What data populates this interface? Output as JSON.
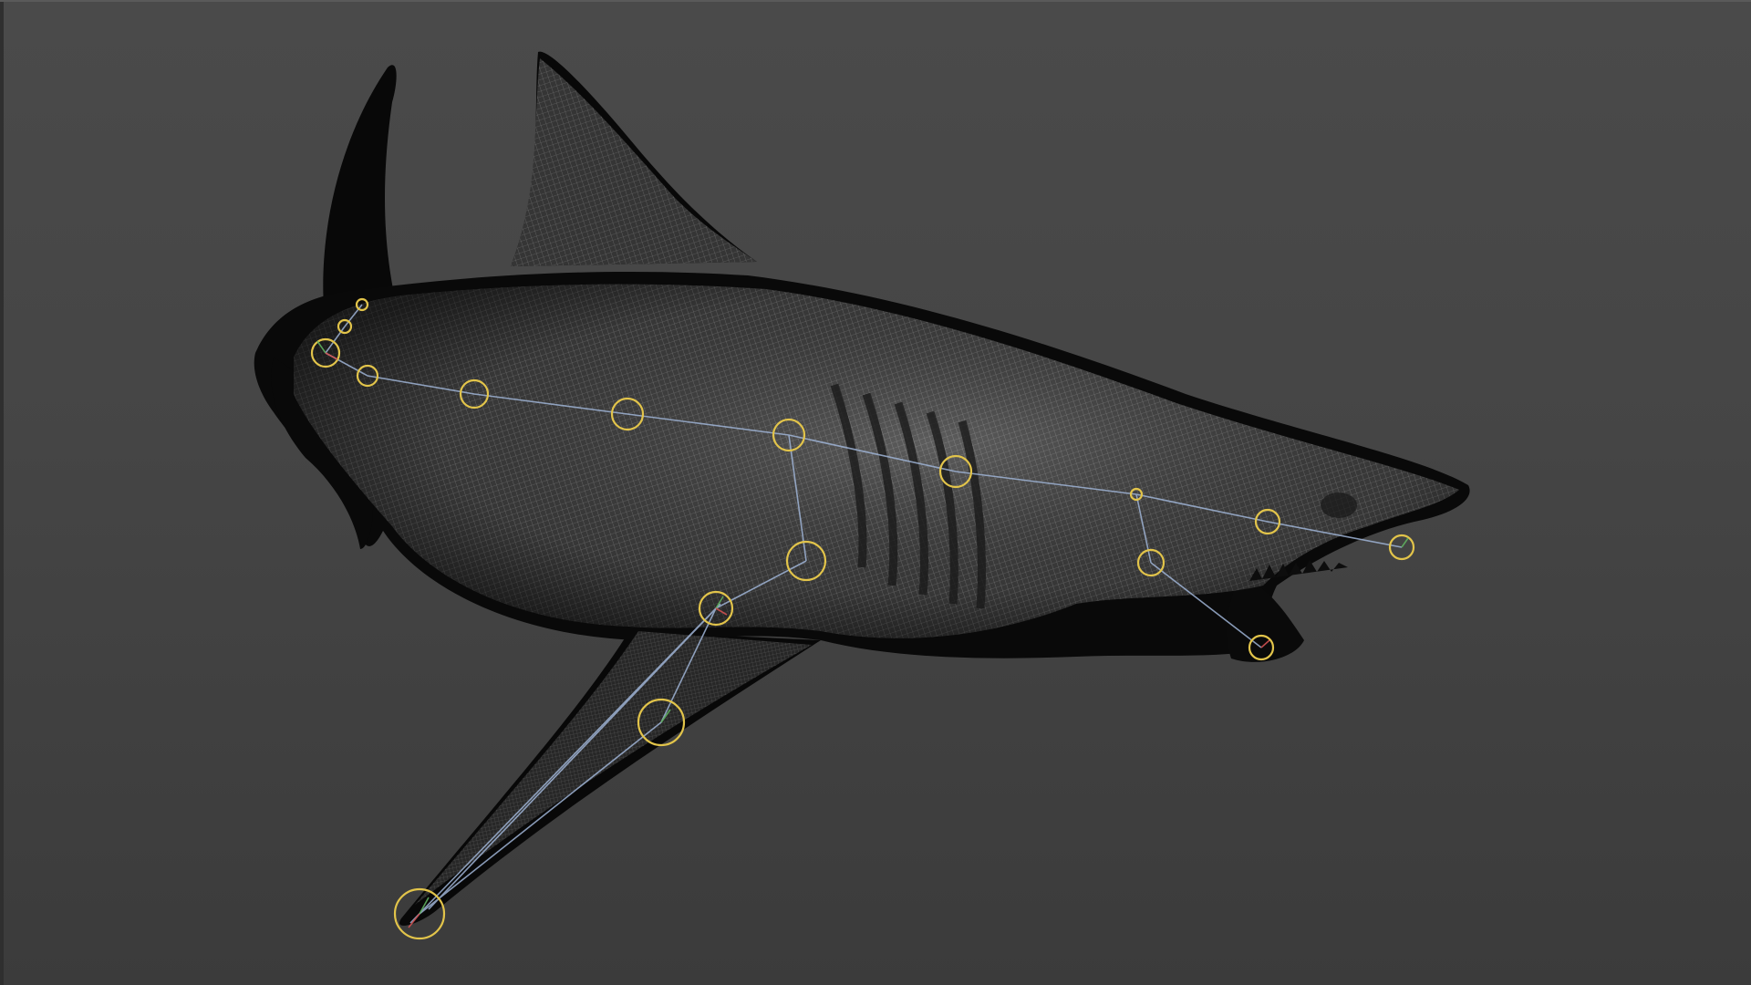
{
  "viewport": {
    "background_top": "#4a4a4a",
    "background_bottom": "#3b3b3b",
    "model": "shark-wireframe-mesh"
  },
  "colors": {
    "silhouette": "#0a0a0a",
    "mesh_fill": "#3c3c3c",
    "wire": "#cfcfcf",
    "bone_line": "#9fb4d6",
    "joint_ring": "#e2c44a"
  },
  "icons": {
    "joint": "joint-circle-icon",
    "bone": "bone-line-icon"
  }
}
